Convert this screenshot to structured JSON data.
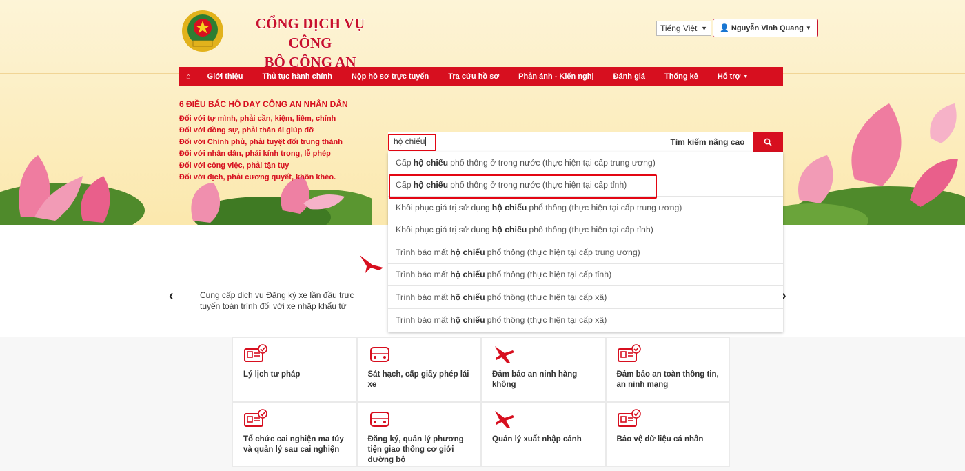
{
  "header": {
    "title_line1": "CỔNG DỊCH VỤ CÔNG",
    "title_line2": "BỘ CÔNG AN",
    "language": "Tiếng Việt",
    "user_name": "Nguyễn Vinh Quang"
  },
  "nav": {
    "items": [
      {
        "label": "Giới thiệu"
      },
      {
        "label": "Thủ tục hành chính"
      },
      {
        "label": "Nộp hồ sơ trực tuyến"
      },
      {
        "label": "Tra cứu hồ sơ"
      },
      {
        "label": "Phản ánh - Kiến nghị"
      },
      {
        "label": "Đánh giá"
      },
      {
        "label": "Thống kê"
      },
      {
        "label": "Hỗ trợ"
      }
    ]
  },
  "mottos": {
    "heading": "6 ĐIỀU BÁC HỒ DẠY CÔNG AN NHÂN DÂN",
    "lines": [
      "Đối với tự mình, phải cần, kiệm, liêm, chính",
      "Đối với đồng sự, phải thân ái giúp đỡ",
      "Đối với Chính phủ, phải tuyệt đối trung thành",
      "Đối với nhân dân, phải kính trọng, lễ phép",
      "Đối với công việc, phải tận tụy",
      "Đối với địch, phải cương quyết, khôn khéo."
    ]
  },
  "search": {
    "value": "hộ chiếu",
    "advanced_label": "Tìm kiếm nâng cao",
    "suggestions": [
      {
        "pre": "Cấp",
        "kw": "hộ chiếu",
        "post": "phổ thông ở trong nước (thực hiện tại cấp trung ương)"
      },
      {
        "pre": "Cấp",
        "kw": "hộ chiếu",
        "post": "phổ thông ở trong nước (thực hiện tại cấp tỉnh)"
      },
      {
        "pre": "Khôi phục giá trị sử dụng",
        "kw": "hộ chiếu",
        "post": "phổ thông (thực hiện tại cấp trung ương)"
      },
      {
        "pre": "Khôi phục giá trị sử dụng",
        "kw": "hộ chiếu",
        "post": "phổ thông (thực hiện tại cấp tỉnh)"
      },
      {
        "pre": "Trình báo mất",
        "kw": "hộ chiếu",
        "post": "phổ thông (thực hiện tại cấp trung ương)"
      },
      {
        "pre": "Trình báo mất",
        "kw": "hộ chiếu",
        "post": "phổ thông (thực hiện tại cấp tỉnh)"
      },
      {
        "pre": "Trình báo mất",
        "kw": "hộ chiếu",
        "post": "phổ thông (thực hiện tại cấp xã)"
      },
      {
        "pre": "Trình báo mất",
        "kw": "hộ chiếu",
        "post": "phổ thông (thực hiện tại cấp xã)"
      }
    ]
  },
  "slider": {
    "text": "Cung cấp dịch vụ Đăng ký xe lần đầu trực tuyến toàn trình đối với xe nhập khẩu từ"
  },
  "services": [
    {
      "title": "Lý lịch tư pháp",
      "icon": "id-card-icon"
    },
    {
      "title": "Sát hạch, cấp giấy phép lái xe",
      "icon": "car-icon"
    },
    {
      "title": "Đảm bảo an ninh hàng không",
      "icon": "airplane-icon"
    },
    {
      "title": "Đảm bảo an toàn thông tin, an ninh mạng",
      "icon": "id-card-icon"
    },
    {
      "title": "Tổ chức cai nghiện ma túy và quản lý sau cai nghiện",
      "icon": "id-card-icon"
    },
    {
      "title": "Đăng ký, quản lý phương tiện giao thông cơ giới đường bộ",
      "icon": "car-icon"
    },
    {
      "title": "Quản lý xuất nhập cảnh",
      "icon": "airplane-icon"
    },
    {
      "title": "Bảo vệ dữ liệu cá nhân",
      "icon": "id-card-icon"
    }
  ],
  "colors": {
    "accent": "#d70f1f",
    "highlight": "#e30613",
    "banner": "#fbe8ad"
  }
}
